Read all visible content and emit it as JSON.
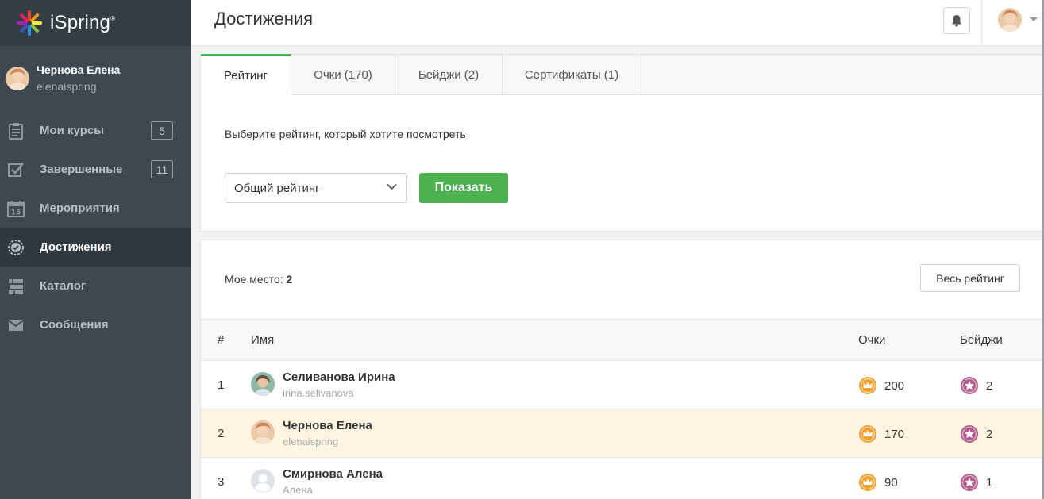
{
  "brand": {
    "name": "iSpring"
  },
  "user": {
    "name": "Чернова Елена",
    "login": "elenaispring"
  },
  "sidebar": {
    "items": [
      {
        "label": "Мои курсы",
        "badge": "5"
      },
      {
        "label": "Завершенные",
        "badge": "11"
      },
      {
        "label": "Мероприятия"
      },
      {
        "label": "Достижения",
        "active": true
      },
      {
        "label": "Каталог"
      },
      {
        "label": "Сообщения"
      }
    ]
  },
  "header": {
    "title": "Достижения"
  },
  "tabs": [
    {
      "label": "Рейтинг",
      "active": true
    },
    {
      "label": "Очки (170)"
    },
    {
      "label": "Бейджи (2)"
    },
    {
      "label": "Сертификаты (1)"
    }
  ],
  "rating_form": {
    "prompt": "Выберите рейтинг, который хотите посмотреть",
    "selected": "Общий рейтинг",
    "show_label": "Показать"
  },
  "leaderboard": {
    "my_place_label": "Мое место:",
    "my_place_value": "2",
    "all_button": "Весь рейтинг",
    "columns": {
      "num": "#",
      "name": "Имя",
      "points": "Очки",
      "badges": "Бейджи"
    },
    "rows": [
      {
        "num": "1",
        "name": "Селиванова Ирина",
        "login": "irina.selivanova",
        "points": "200",
        "badges": "2"
      },
      {
        "num": "2",
        "name": "Чернова Елена",
        "login": "elenaispring",
        "points": "170",
        "badges": "2",
        "is_me": true
      },
      {
        "num": "3",
        "name": "Смирнова Алена",
        "login": "Алена",
        "points": "90",
        "badges": "1"
      }
    ]
  },
  "colors": {
    "sidebar_bg": "#3d4850",
    "accent_green": "#4bb24f",
    "highlight_row": "#fff5e0",
    "coin": "#f0a030",
    "badge_star": "#b25a8c"
  }
}
